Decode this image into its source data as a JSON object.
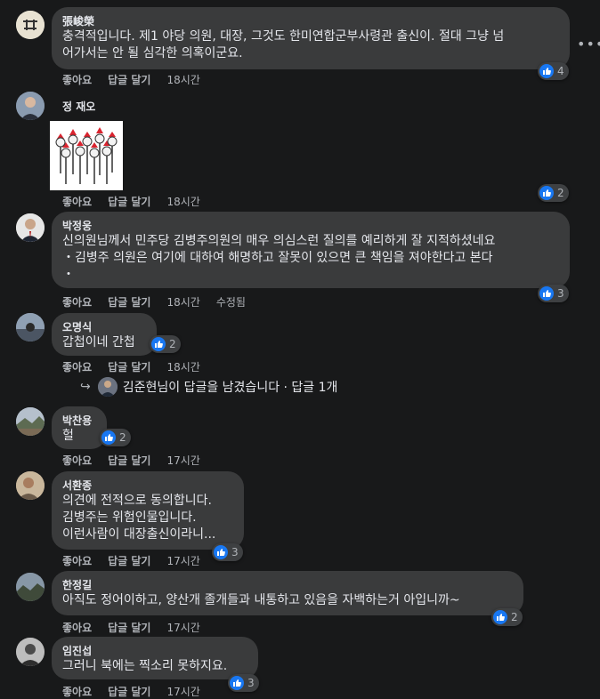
{
  "comments": [
    {
      "author": "張峻榮",
      "text": "충격적입니다. 제1 야당 의원, 대장, 그것도 한미연합군부사령관 출신이. 절대 그냥 넘\n어가서는 안 될 심각한 의혹이군요.",
      "like": "좋아요",
      "reply": "답글 달기",
      "time": "18시간",
      "reactions": "4"
    },
    {
      "author": "정 재오",
      "like": "좋아요",
      "reply": "답글 달기",
      "time": "18시간",
      "reactions": "2"
    },
    {
      "author": "박정웅",
      "text": "신의원님께서 민주당 김병주의원의 매우 의심스런 질의를 예리하게 잘 지적하셨네요\n・김병주 의원은 여기에 대하여 해명하고 잘못이 있으면 큰 책임을 져야한다고 본다\n・",
      "like": "좋아요",
      "reply": "답글 달기",
      "time": "18시간",
      "edited": "수정됨",
      "reactions": "3"
    },
    {
      "author": "오명식",
      "text": "갑첩이네 간첩",
      "like": "좋아요",
      "reply": "답글 달기",
      "time": "18시간",
      "reactions": "2",
      "reply_summary": "김준현님이 답글을 남겼습니다 · 답글 1개"
    },
    {
      "author": "박찬용",
      "text": "헐",
      "like": "좋아요",
      "reply": "답글 달기",
      "time": "17시간",
      "reactions": "2"
    },
    {
      "author": "서환종",
      "text": "의견에 전적으로 동의합니다.\n김병주는 위험인물입니다.\n이런사람이 대장출신이라니...",
      "like": "좋아요",
      "reply": "답글 달기",
      "time": "17시간",
      "reactions": "3"
    },
    {
      "author": "한정길",
      "text": "아직도 정어이하고, 양산개 졸개들과 내통하고 있음을 자백하는거 아입니까~",
      "like": "좋아요",
      "reply": "답글 달기",
      "time": "17시간",
      "reactions": "2"
    },
    {
      "author": "임진섭",
      "text": "그러니 북에는 찍소리 못하지요.",
      "like": "좋아요",
      "reply": "답글 달기",
      "time": "17시간",
      "reactions": "3"
    }
  ],
  "colors": {
    "like_blue": "#1877f2",
    "bubble": "#3a3b3c",
    "bg": "#18191a"
  },
  "icons": {
    "more": "more-options-icon",
    "like": "thumbs-up-icon",
    "reply_arrow": "reply-arrow-icon"
  }
}
